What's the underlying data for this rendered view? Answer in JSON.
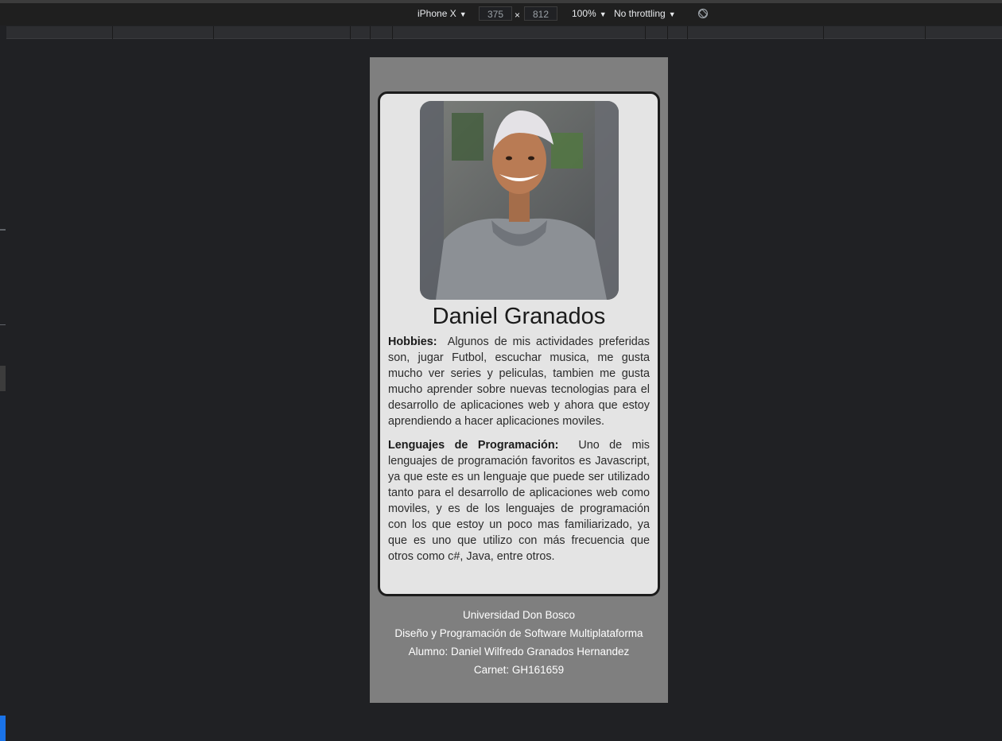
{
  "devtools": {
    "device": "iPhone X",
    "width": "375",
    "times": "×",
    "height": "812",
    "zoom": "100%",
    "throttling": "No throttling",
    "rotate_icon": "rotate-icon"
  },
  "profile": {
    "photo_icon": "portrait-photo",
    "name": "Daniel Granados",
    "hobbies_label": "Hobbies:",
    "hobbies_text": "Algunos de mis actividades preferidas son, jugar Futbol, escuchar musica, me gusta mucho ver series y peliculas, tambien me gusta mucho aprender sobre nuevas tecnologias para el desarrollo de aplicaciones web y ahora que estoy aprendiendo a hacer aplicaciones moviles.",
    "languages_label": "Lenguajes de Programación:",
    "languages_text": "Uno de mis lenguajes de programación favoritos es Javascript, ya que este es un lenguaje que puede ser utilizado tanto para el desarrollo de aplicaciones web como moviles, y es de los lenguajes de programación con los que estoy un poco mas familiarizado, ya que es uno que utilizo con más frecuencia que otros como c#, Java, entre otros."
  },
  "footer": {
    "university": "Universidad Don Bosco",
    "career": "Diseño y Programación de Software Multiplataforma",
    "student": "Alumno: Daniel Wilfredo Granados Hernandez",
    "carnet": "Carnet: GH161659"
  },
  "colors": {
    "devtools_bg": "#202124",
    "viewport_bg": "#7f7f7f",
    "card_bg": "#e4e4e4",
    "card_border": "#1b1b1b"
  }
}
